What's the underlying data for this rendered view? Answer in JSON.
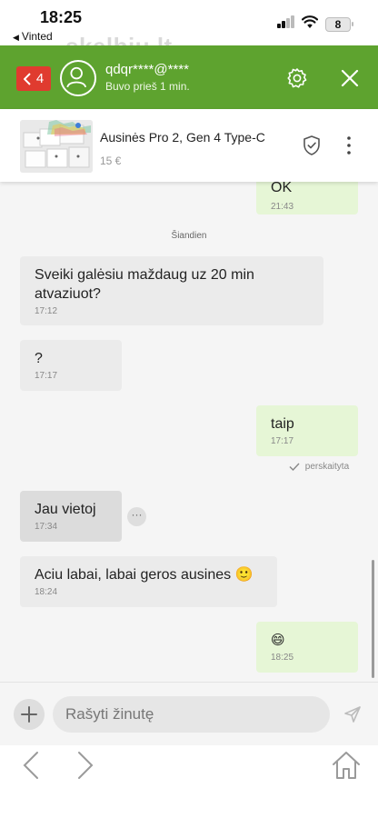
{
  "status_bar": {
    "time": "18:25",
    "back_app": "Vinted",
    "battery": "8",
    "watermark": "skelbiu.lt"
  },
  "header": {
    "back_count": "4",
    "username": "qdqr****@****",
    "last_seen": "Buvo prieš 1 min."
  },
  "listing": {
    "title": "Ausinės Pro 2, Gen 4 Type-C",
    "price": "15 €"
  },
  "chat": {
    "date_separator": "Šiandien",
    "read_status": "perskaityta",
    "messages": [
      {
        "direction": "out",
        "text": "OK",
        "time": "21:43"
      },
      {
        "direction": "in",
        "text": "Sveiki galėsiu maždaug uz 20 min atvaziuot?",
        "time": "17:12"
      },
      {
        "direction": "in",
        "text": "?",
        "time": "17:17"
      },
      {
        "direction": "out",
        "text": "taip",
        "time": "17:17"
      },
      {
        "direction": "in",
        "text": "Jau vietoj",
        "time": "17:34"
      },
      {
        "direction": "in",
        "text": "Aciu labai, labai geros ausines 🙂",
        "time": "18:24"
      },
      {
        "direction": "out",
        "text": "😄",
        "time": "18:25"
      }
    ]
  },
  "input": {
    "placeholder": "Rašyti žinutę"
  },
  "colors": {
    "header_green": "#5ea32f",
    "badge_red": "#e03b2f",
    "outgoing_bubble": "#e6f6d6",
    "incoming_bubble": "#ebebeb"
  },
  "icons": {
    "back": "chevron-left-icon",
    "avatar": "user-icon",
    "settings": "gear-icon",
    "close": "close-icon",
    "protection": "shield-check-icon",
    "more": "more-vertical-icon",
    "add": "plus-icon",
    "send": "send-icon",
    "nav_back": "chevron-left-icon",
    "nav_forward": "chevron-right-icon",
    "home": "home-icon"
  }
}
